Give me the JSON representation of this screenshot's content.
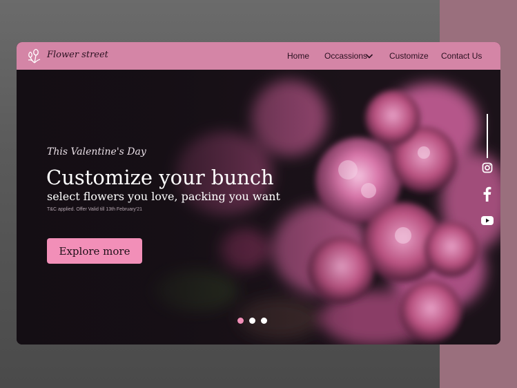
{
  "brand": {
    "name": "Flower street"
  },
  "nav": {
    "items": [
      {
        "label": "Home"
      },
      {
        "label": "Occassions"
      },
      {
        "label": "Customize"
      },
      {
        "label": "Contact Us"
      }
    ]
  },
  "hero": {
    "eyebrow": "This Valentine's Day",
    "headline": "Customize your bunch",
    "subhead": "select flowers you love, packing you want",
    "terms": "T&C applied. Offer Valid till 13th February'21",
    "cta_label": "Explore more"
  },
  "carousel": {
    "slide_count": 3,
    "active_index": 0
  },
  "social": [
    "instagram-icon",
    "facebook-icon",
    "youtube-icon"
  ],
  "colors": {
    "accent": "#f28fb8",
    "navbar": "#d485a6",
    "side_band": "#9a6f7d",
    "hero_dark": "#1a1219"
  }
}
